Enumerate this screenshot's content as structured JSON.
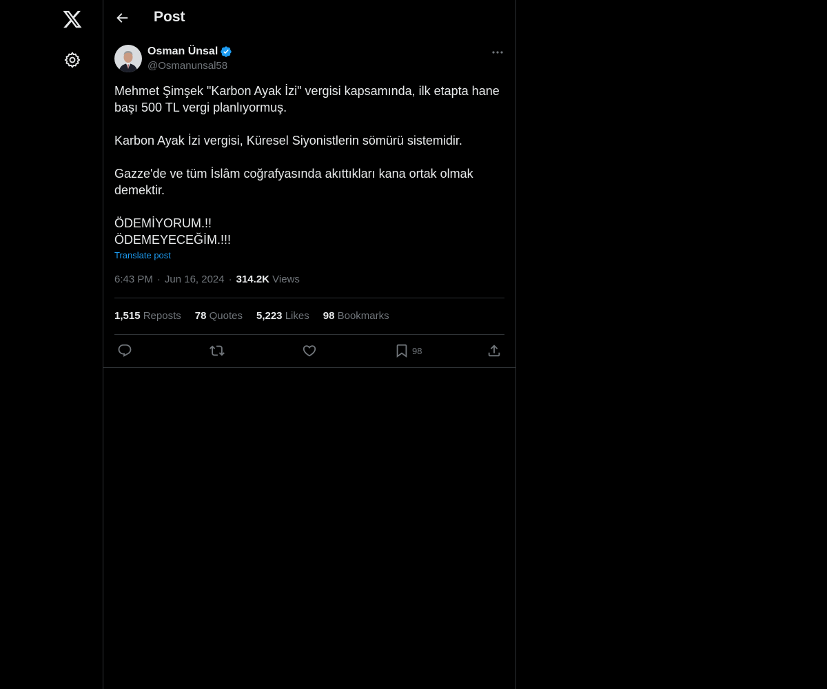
{
  "nav": {
    "logo_icon": "x-logo-icon",
    "settings_icon": "gear-icon"
  },
  "header": {
    "title": "Post",
    "back_icon": "arrow-left-icon"
  },
  "post": {
    "author": {
      "name": "Osman Ünsal",
      "handle": "@Osmanunsal58",
      "verified": true,
      "verified_color": "#1d9bf0"
    },
    "paragraphs": [
      "Mehmet Şimşek \"Karbon Ayak İzi\" vergisi kapsamında, ilk etapta hane başı 500 TL vergi planlıyormuş.",
      "Karbon Ayak İzi vergisi, Küresel Siyonistlerin sömürü sistemidir.",
      "Gazze'de ve tüm İslâm coğrafyasında akıttıkları kana ortak olmak demektir.",
      "ÖDEMİYORUM.!!\nÖDEMEYECEĞİM.!!!"
    ],
    "translate_label": "Translate post",
    "time": "6:43 PM",
    "date": "Jun 16, 2024",
    "views_count": "314.2K",
    "views_label": "Views",
    "stats": {
      "reposts": {
        "count": "1,515",
        "label": "Reposts"
      },
      "quotes": {
        "count": "78",
        "label": "Quotes"
      },
      "likes": {
        "count": "5,223",
        "label": "Likes"
      },
      "bookmarks": {
        "count": "98",
        "label": "Bookmarks"
      }
    },
    "actions": {
      "reply_icon": "reply-icon",
      "repost_icon": "repost-icon",
      "like_icon": "heart-icon",
      "bookmark_icon": "bookmark-icon",
      "bookmark_count": "98",
      "share_icon": "share-icon"
    }
  },
  "colors": {
    "background": "#000000",
    "text": "#e7e9ea",
    "muted": "#71767b",
    "accent": "#1d9bf0",
    "border": "#2f3336"
  }
}
